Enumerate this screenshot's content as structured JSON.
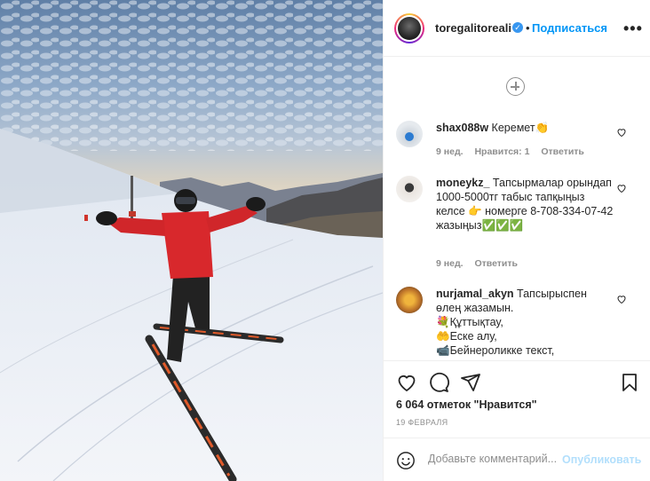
{
  "post": {
    "author": "toregalitoreali",
    "separator": "•",
    "follow_label": "Подписаться",
    "more_label": "•••"
  },
  "comments": [
    {
      "username": "shax088w",
      "text": " Керемет👏",
      "meta": [
        "9 нед.",
        "Нравится: 1",
        "Ответить"
      ]
    },
    {
      "username": "moneykz_",
      "text": " Тапсырмалар орындап 1000-5000тг табыс тапқыңыз келсе 👉 номерге 8-708-334-07-42 жазыңыз✅✅✅",
      "meta": [
        "9 нед.",
        "Ответить"
      ]
    },
    {
      "username": "nurjamal_akyn",
      "text": " Тапсырыспен өлең жазамын.",
      "lines": [
        "💐Құттықтау,",
        "🤲Еске алу,",
        "📹Бейнероликке текст,"
      ]
    }
  ],
  "stats": {
    "likes": "6 064 отметок \"Нравится\"",
    "date": "19 февраля"
  },
  "add_comment": {
    "placeholder": "Добавьте комментарий...",
    "publish_label": "Опубликовать"
  },
  "colors": {
    "accent": "#0095f6",
    "publish_disabled": "#b2dffc",
    "text": "#262626",
    "muted": "#8e8e8e",
    "jacket": "#d8282c"
  }
}
